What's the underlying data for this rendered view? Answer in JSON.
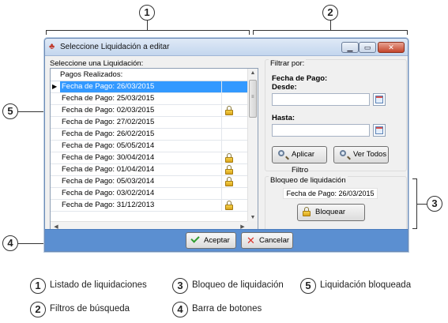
{
  "callouts": {
    "top_left": "1",
    "top_right": "2",
    "right": "3",
    "bottom_left": "4",
    "left": "5"
  },
  "window": {
    "title": "Seleccione Liquidación a editar",
    "controls": [
      "minimize-icon",
      "maximize-icon",
      "close-icon"
    ]
  },
  "list_panel": {
    "label": "Seleccione una Liquidación:",
    "header": "Pagos Realizados:",
    "rows": [
      {
        "date": "Fecha de Pago: 26/03/2015",
        "locked": false,
        "selected": true
      },
      {
        "date": "Fecha de Pago: 25/03/2015",
        "locked": false,
        "selected": false
      },
      {
        "date": "Fecha de Pago: 02/03/2015",
        "locked": true,
        "selected": false
      },
      {
        "date": "Fecha de Pago: 27/02/2015",
        "locked": false,
        "selected": false
      },
      {
        "date": "Fecha de Pago: 26/02/2015",
        "locked": false,
        "selected": false
      },
      {
        "date": "Fecha de Pago: 05/05/2014",
        "locked": false,
        "selected": false
      },
      {
        "date": "Fecha de Pago: 30/04/2014",
        "locked": true,
        "selected": false
      },
      {
        "date": "Fecha de Pago: 01/04/2014",
        "locked": true,
        "selected": false
      },
      {
        "date": "Fecha de Pago: 05/03/2014",
        "locked": true,
        "selected": false
      },
      {
        "date": "Fecha de Pago: 03/02/2014",
        "locked": false,
        "selected": false
      },
      {
        "date": "Fecha de Pago: 31/12/2013",
        "locked": true,
        "selected": false
      }
    ]
  },
  "filter_panel": {
    "title": "Filtrar por:",
    "fecha_label": "Fecha de Pago:",
    "desde_label": "Desde:",
    "desde_value": "",
    "hasta_label": "Hasta:",
    "hasta_value": "",
    "apply_label": "Aplicar Filtro",
    "view_all_label": "Ver Todos"
  },
  "bloqueo_panel": {
    "title": "Bloqueo de liquidación",
    "value": "Fecha de Pago: 26/03/2015",
    "button_label": "Bloquear"
  },
  "footer": {
    "accept_label": "Aceptar",
    "cancel_label": "Cancelar"
  },
  "legend": [
    {
      "num": "1",
      "text": "Listado de liquidaciones"
    },
    {
      "num": "3",
      "text": "Bloqueo de liquidación"
    },
    {
      "num": "5",
      "text": "Liquidación bloqueada"
    },
    {
      "num": "2",
      "text": "Filtros de búsqueda"
    },
    {
      "num": "4",
      "text": "Barra de botones"
    }
  ],
  "colors": {
    "selection": "#3399ff",
    "footer": "#5b8fd1",
    "title_bar": "#c3d6ee"
  }
}
